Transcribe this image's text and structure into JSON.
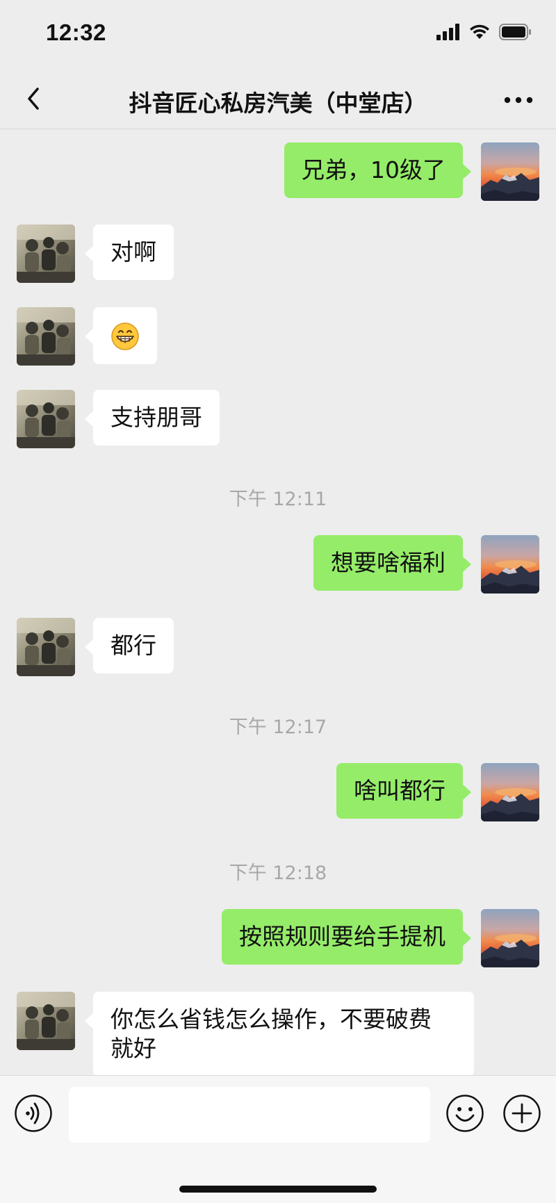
{
  "status_bar": {
    "time": "12:32",
    "icons": [
      "signal-icon",
      "wifi-icon",
      "battery-icon"
    ]
  },
  "nav": {
    "back_icon": "chevron-left-icon",
    "title": "抖音匠心私房汽美（中堂店）",
    "more_icon": "more-dots-icon"
  },
  "messages": [
    {
      "sender": "me",
      "text": "兄弟，10级了"
    },
    {
      "sender": "friend",
      "text": "对啊"
    },
    {
      "sender": "friend",
      "emoji": "grinning-face-icon"
    },
    {
      "sender": "friend",
      "text": "支持朋哥"
    },
    {
      "type": "time",
      "text": "下午 12:11"
    },
    {
      "sender": "me",
      "text": "想要啥福利"
    },
    {
      "sender": "friend",
      "text": "都行"
    },
    {
      "type": "time",
      "text": "下午 12:17"
    },
    {
      "sender": "me",
      "text": "啥叫都行"
    },
    {
      "type": "time",
      "text": "下午 12:18"
    },
    {
      "sender": "me",
      "text": "按照规则要给手提机"
    },
    {
      "sender": "friend",
      "text_lines": [
        "你怎么省钱怎么操作，不要破费",
        "就好"
      ]
    }
  ],
  "input_bar": {
    "voice_icon": "voice-icon",
    "input_value": "",
    "emoji_icon": "smiley-icon",
    "plus_icon": "plus-circle-icon"
  },
  "colors": {
    "background": "#EDEDED",
    "my_bubble": "#95EC69",
    "friend_bubble": "#FFFFFF",
    "timestamp": "#A8A8A8"
  }
}
